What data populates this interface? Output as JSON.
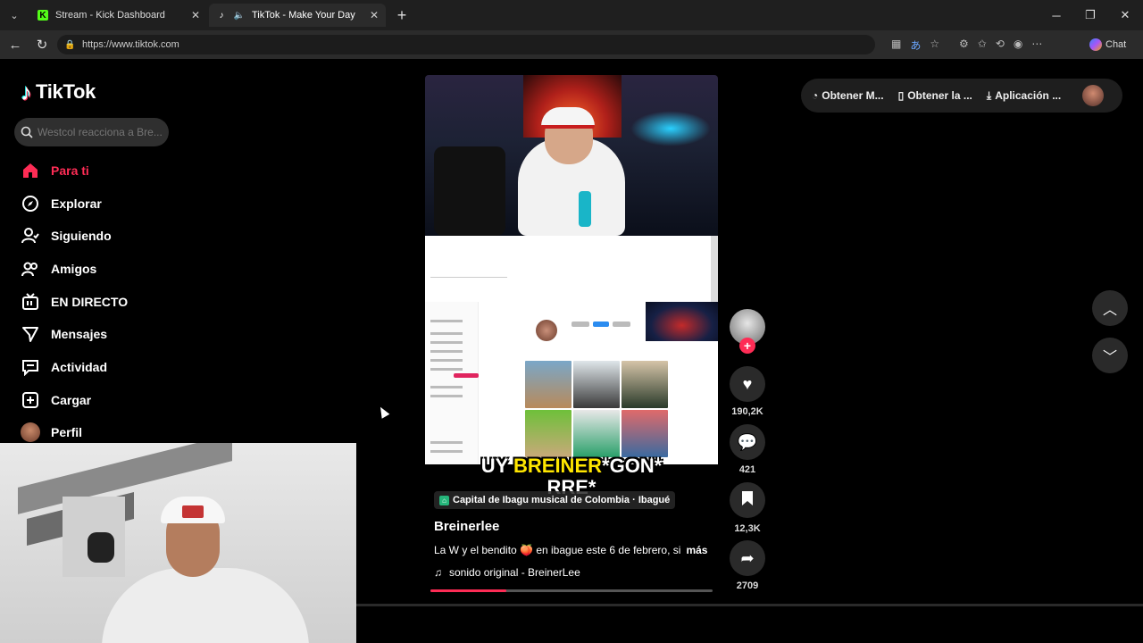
{
  "browser": {
    "tabs": [
      {
        "title": "Stream - Kick Dashboard",
        "icon": "kick-icon"
      },
      {
        "title": "TikTok - Make Your Day",
        "icon": "tiktok-icon"
      }
    ],
    "url": "https://www.tiktok.com",
    "chat_label": "Chat"
  },
  "tiktok": {
    "logo_text": "TikTok",
    "search": {
      "placeholder": "Westcol reacciona a Bre..."
    },
    "nav": [
      {
        "label": "Para ti",
        "icon": "home-icon",
        "active": true
      },
      {
        "label": "Explorar",
        "icon": "compass-icon"
      },
      {
        "label": "Siguiendo",
        "icon": "following-icon"
      },
      {
        "label": "Amigos",
        "icon": "friends-icon"
      },
      {
        "label": "EN DIRECTO",
        "icon": "live-icon"
      },
      {
        "label": "Mensajes",
        "icon": "messages-icon"
      },
      {
        "label": "Actividad",
        "icon": "activity-icon"
      },
      {
        "label": "Cargar",
        "icon": "upload-icon"
      },
      {
        "label": "Perfil",
        "icon": "profile-avatar"
      }
    ],
    "top_actions": [
      "Obtener M...",
      "Obtener la ...",
      "Aplicación ..."
    ],
    "video": {
      "subtitle_plain1": "UY ",
      "subtitle_highlight": "BREINER",
      "subtitle_plain2": "*GON*",
      "subtitle_line2": "RRE*",
      "location": "Capital de Ibagu musical de Colombia · Ibagué",
      "author": "Breinerlee",
      "description": "La W y el bendito 🍑 en ibague este 6 de febrero, si",
      "more": "más",
      "sound": "sonido original - BreinerLee",
      "progress": 0.27
    },
    "actions": {
      "likes": "190,2K",
      "comments": "421",
      "saves": "12,3K",
      "shares": "2709"
    }
  },
  "colors": {
    "accent": "#fe2c55",
    "subtitle_highlight": "#ffe600"
  }
}
